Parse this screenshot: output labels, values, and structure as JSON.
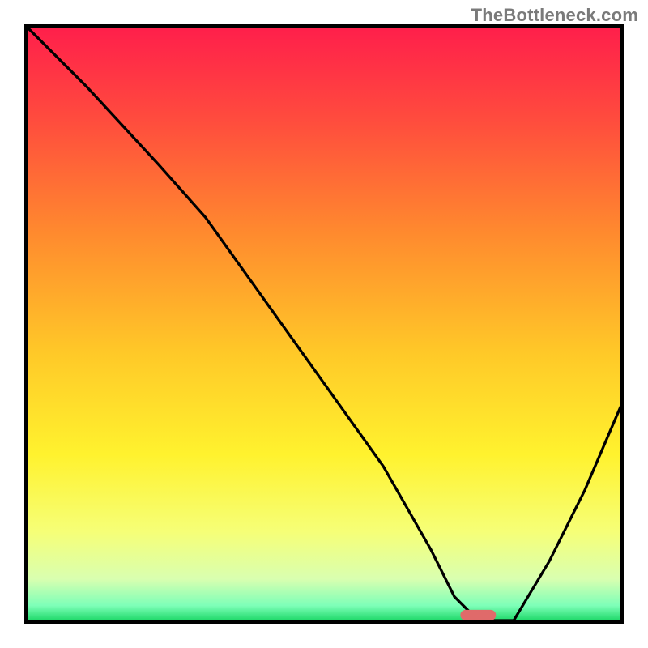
{
  "watermark": "TheBottleneck.com",
  "chart_data": {
    "type": "line",
    "title": "",
    "xlabel": "",
    "ylabel": "",
    "xlim": [
      0,
      100
    ],
    "ylim": [
      0,
      100
    ],
    "grid": false,
    "legend": false,
    "background_gradient": {
      "stops": [
        {
          "offset": 0.0,
          "color": "#ff1f4b"
        },
        {
          "offset": 0.15,
          "color": "#ff4a3e"
        },
        {
          "offset": 0.35,
          "color": "#ff8b2e"
        },
        {
          "offset": 0.55,
          "color": "#ffc928"
        },
        {
          "offset": 0.72,
          "color": "#fff22e"
        },
        {
          "offset": 0.85,
          "color": "#f6ff77"
        },
        {
          "offset": 0.93,
          "color": "#d9ffb0"
        },
        {
          "offset": 0.975,
          "color": "#7dffb8"
        },
        {
          "offset": 1.0,
          "color": "#1fd96a"
        }
      ]
    },
    "series": [
      {
        "name": "bottleneck-curve",
        "color": "#000000",
        "stroke_width": 3,
        "x": [
          0,
          10,
          22,
          30,
          40,
          50,
          60,
          68,
          72,
          76,
          82,
          88,
          94,
          100
        ],
        "values": [
          100,
          90,
          77,
          68,
          54,
          40,
          26,
          12,
          4,
          0,
          0,
          10,
          22,
          36
        ]
      }
    ],
    "marker": {
      "name": "optimum-marker",
      "x_start": 73,
      "x_end": 79,
      "y": 0,
      "color": "#e06a6a",
      "shape": "rounded-bar"
    }
  }
}
